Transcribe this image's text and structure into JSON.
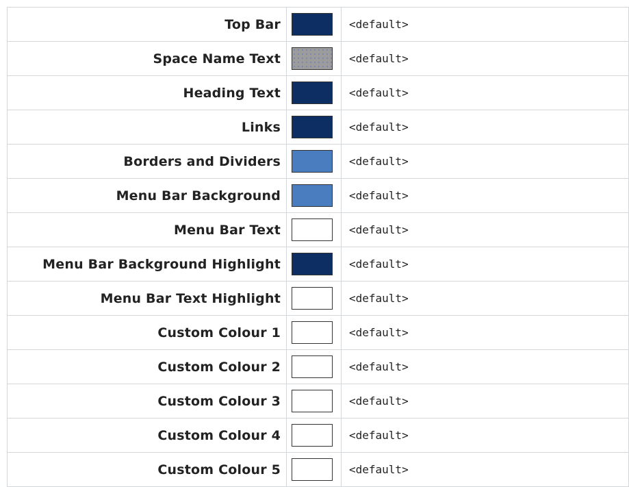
{
  "rows": [
    {
      "label": "Top Bar",
      "value": "<default>",
      "color": "#0d2e63"
    },
    {
      "label": "Space Name Text",
      "value": "<default>",
      "color": "transparent"
    },
    {
      "label": "Heading Text",
      "value": "<default>",
      "color": "#0d2e63"
    },
    {
      "label": "Links",
      "value": "<default>",
      "color": "#0d2e63"
    },
    {
      "label": "Borders and Dividers",
      "value": "<default>",
      "color": "#4a7dbf"
    },
    {
      "label": "Menu Bar Background",
      "value": "<default>",
      "color": "#4a7dbf"
    },
    {
      "label": "Menu Bar Text",
      "value": "<default>",
      "color": "#ffffff"
    },
    {
      "label": "Menu Bar Background Highlight",
      "value": "<default>",
      "color": "#0d2e63"
    },
    {
      "label": "Menu Bar Text Highlight",
      "value": "<default>",
      "color": "#ffffff"
    },
    {
      "label": "Custom Colour 1",
      "value": "<default>",
      "color": "#ffffff"
    },
    {
      "label": "Custom Colour 2",
      "value": "<default>",
      "color": "#ffffff"
    },
    {
      "label": "Custom Colour 3",
      "value": "<default>",
      "color": "#ffffff"
    },
    {
      "label": "Custom Colour 4",
      "value": "<default>",
      "color": "#ffffff"
    },
    {
      "label": "Custom Colour 5",
      "value": "<default>",
      "color": "#ffffff"
    }
  ]
}
